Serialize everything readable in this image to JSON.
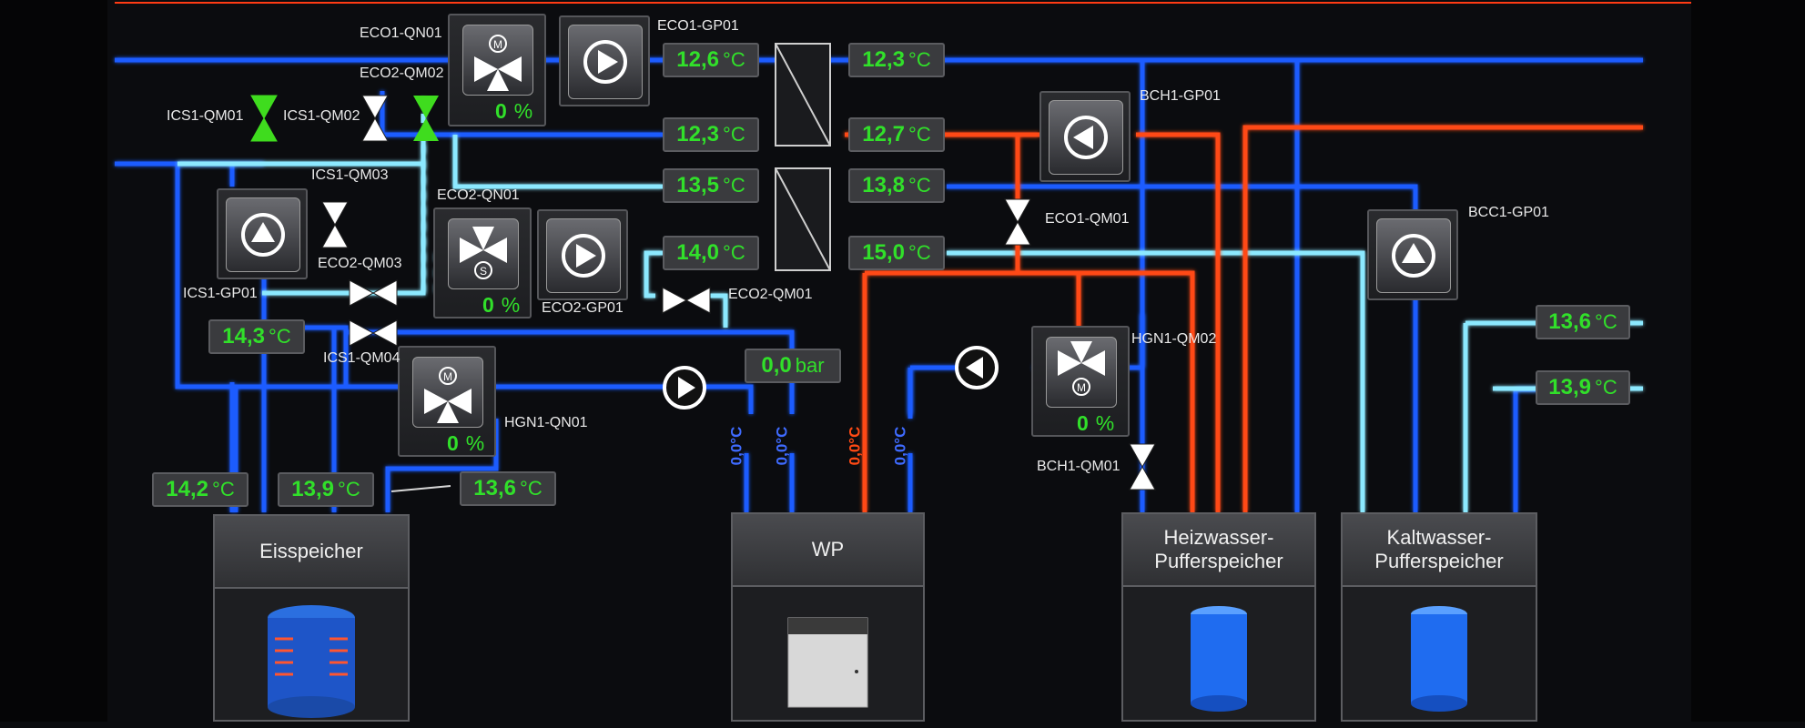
{
  "colors": {
    "cold_pipe": "#1f5cff",
    "cyan_pipe": "#8ce9ff",
    "hot_pipe": "#ff4a14",
    "value_green": "#31e02a",
    "valve_green": "#3fdc1e",
    "panel_bg": "#0b0c0f"
  },
  "labels": {
    "eco1_qn01": "ECO1-QN01",
    "eco2_qm02": "ECO2-QM02",
    "eco1_gp01": "ECO1-GP01",
    "ics1_qm01": "ICS1-QM01",
    "ics1_qm02": "ICS1-QM02",
    "ics1_qm03": "ICS1-QM03",
    "eco2_qn01": "ECO2-QN01",
    "eco2_qm03": "ECO2-QM03",
    "ics1_gp01": "ICS1-GP01",
    "ics1_qm04": "ICS1-QM04",
    "eco2_gp01": "ECO2-GP01",
    "eco2_qm01": "ECO2-QM01",
    "hgn1_qn01": "HGN1-QN01",
    "bch1_gp01": "BCH1-GP01",
    "eco1_qm01": "ECO1-QM01",
    "bcc1_gp01": "BCC1-GP01",
    "hgn1_qm02": "HGN1-QM02",
    "bch1_qm01": "BCH1-QM01"
  },
  "readings": {
    "r1": {
      "value": "12,6",
      "unit": "°C"
    },
    "r2": {
      "value": "12,3",
      "unit": "°C"
    },
    "r3": {
      "value": "12,3",
      "unit": "°C"
    },
    "r4": {
      "value": "12,7",
      "unit": "°C"
    },
    "r5": {
      "value": "13,5",
      "unit": "°C"
    },
    "r6": {
      "value": "13,8",
      "unit": "°C"
    },
    "r7": {
      "value": "14,0",
      "unit": "°C"
    },
    "r8": {
      "value": "15,0",
      "unit": "°C"
    },
    "r9": {
      "value": "14,3",
      "unit": "°C"
    },
    "r10": {
      "value": "0,0",
      "unit": "bar"
    },
    "r11": {
      "value": "14,2",
      "unit": "°C"
    },
    "r12": {
      "value": "13,9",
      "unit": "°C"
    },
    "r13": {
      "value": "13,6",
      "unit": "°C"
    },
    "r14": {
      "value": "13,6",
      "unit": "°C"
    },
    "r15": {
      "value": "13,9",
      "unit": "°C"
    }
  },
  "valve_positions": {
    "eco1_qn01": {
      "value": "0",
      "unit": "%"
    },
    "eco2_qn01": {
      "value": "0",
      "unit": "%"
    },
    "hgn1_qn01": {
      "value": "0",
      "unit": "%"
    },
    "hgn1_qm02": {
      "value": "0",
      "unit": "%"
    }
  },
  "wp_connections": {
    "c1": "0,0°C",
    "c2": "0,0°C",
    "c3": "0,0°C",
    "c4": "0,0°C"
  },
  "tanks": {
    "eisspeicher": "Eisspeicher",
    "wp": "WP",
    "heizwasser": "Heizwasser-\nPufferspeicher",
    "kaltwasser": "Kaltwasser-\nPufferspeicher"
  }
}
